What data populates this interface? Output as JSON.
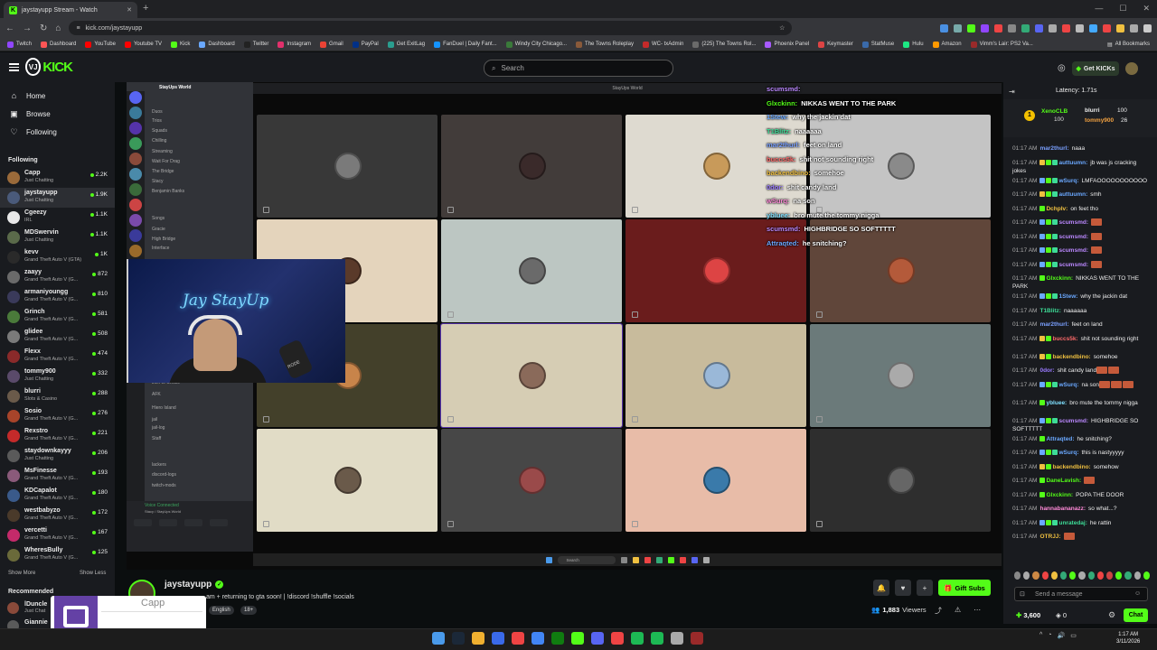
{
  "browser": {
    "tab_title": "jaystayupp Stream - Watch",
    "url": "kick.com/jaystayupp",
    "bookmarks": [
      "Twitch",
      "Dashboard",
      "YouTube",
      "Youtube TV",
      "Kick",
      "Dashboard",
      "Twitter",
      "Instagram",
      "Gmail",
      "PayPal",
      "Get ExitLag",
      "FanDuel | Daily Fant...",
      "Windy City Chicago...",
      "The Towns Roleplay",
      "WC- txAdmin",
      "(225) The Towns Rol...",
      "Phoenix Panel",
      "Keymaster",
      "StatMuse",
      "Hulu",
      "Amazon",
      "Vimm's Lair: PS2 Va..."
    ],
    "all_bookmarks": "All Bookmarks"
  },
  "header": {
    "search_placeholder": "Search",
    "get_kicks": "Get KICKs"
  },
  "nav": {
    "home": "Home",
    "browse": "Browse",
    "following": "Following"
  },
  "following_heading": "Following",
  "following": [
    {
      "name": "Capp",
      "category": "Just Chatting",
      "viewers": "2.2K",
      "color": "#9a6a3a"
    },
    {
      "name": "jaystayupp",
      "category": "Just Chatting",
      "viewers": "1.9K",
      "color": "#4a5a7a"
    },
    {
      "name": "Cgeezy",
      "category": "IRL",
      "viewers": "1.1K",
      "color": "#e8e8e8"
    },
    {
      "name": "MDSwervin",
      "category": "Just Chatting",
      "viewers": "1.1K",
      "color": "#5a6a4a"
    },
    {
      "name": "kevv",
      "category": "Grand Theft Auto V (GTA)",
      "viewers": "1K",
      "color": "#2a2a2a"
    },
    {
      "name": "zaayy",
      "category": "Grand Theft Auto V (G...",
      "viewers": "872",
      "color": "#6a6a6a"
    },
    {
      "name": "armaniyoungg",
      "category": "Grand Theft Auto V (G...",
      "viewers": "810",
      "color": "#3a3a5a"
    },
    {
      "name": "Grinch",
      "category": "Grand Theft Auto V (G...",
      "viewers": "581",
      "color": "#4a7a3a"
    },
    {
      "name": "glidee",
      "category": "Grand Theft Auto V (G...",
      "viewers": "508",
      "color": "#7a7a7a"
    },
    {
      "name": "Flexx",
      "category": "Grand Theft Auto V (G...",
      "viewers": "474",
      "color": "#8a2a2a"
    },
    {
      "name": "tommy900",
      "category": "Just Chatting",
      "viewers": "332",
      "color": "#5a4a6a"
    },
    {
      "name": "blurri",
      "category": "Slots & Casino",
      "viewers": "288",
      "color": "#6a5a4a"
    },
    {
      "name": "Sosio",
      "category": "Grand Theft Auto V (G...",
      "viewers": "276",
      "color": "#a8442a"
    },
    {
      "name": "Rexstro",
      "category": "Grand Theft Auto V (G...",
      "viewers": "221",
      "color": "#c42a2a"
    },
    {
      "name": "staydownkayyy",
      "category": "Just Chatting",
      "viewers": "206",
      "color": "#5a5a5a"
    },
    {
      "name": "MsFinesse",
      "category": "Grand Theft Auto V (G...",
      "viewers": "193",
      "color": "#8a5a7a"
    },
    {
      "name": "KDCapalot",
      "category": "Grand Theft Auto V (G...",
      "viewers": "180",
      "color": "#3a5a8a"
    },
    {
      "name": "westbabyzo",
      "category": "Grand Theft Auto V (G...",
      "viewers": "172",
      "color": "#4a3a2a"
    },
    {
      "name": "vercetti",
      "category": "Grand Theft Auto V (G...",
      "viewers": "167",
      "color": "#c42a6a"
    },
    {
      "name": "WheresBully",
      "category": "Grand Theft Auto V (G...",
      "viewers": "125",
      "color": "#6a6a3a"
    }
  ],
  "show_more": "Show More",
  "show_less": "Show Less",
  "recommended_heading": "Recommended",
  "recommended": [
    {
      "name": "lDuncle",
      "category": "Just Chat",
      "color": "#8a4a3a"
    },
    {
      "name": "Giannie",
      "category": "",
      "color": "#5a5a5a"
    }
  ],
  "stream": {
    "discord_server": "StayUps World",
    "discord_channels": [
      "Duos",
      "Trios",
      "Squads",
      "Chilling",
      "Streaming",
      "Wait For Drag",
      "The Bridge",
      "Stacy",
      "Benjamin Banks",
      "Songs",
      "Gracie",
      "High Bridge",
      "Interface",
      "Join to Create",
      "AFK",
      "Hiero Island",
      "jail",
      "jail-log",
      "Staff",
      "lackers",
      "discord-logs",
      "twitch-mods"
    ],
    "voice_connected": "Voice Connected",
    "voice_sub": "Stacy / StayUps World",
    "window_title": "StayUps World",
    "neon_sign": "Jay StayUp",
    "mic_brand": "RODE",
    "overlay_chat": [
      {
        "user": "scumsmd:",
        "text": "",
        "color": "#bb88ff"
      },
      {
        "user": "Glxckinn:",
        "text": "NIKKAS WENT TO THE PARK",
        "color": "#53fc18"
      },
      {
        "user": "1Stew:",
        "text": "why the jackin dat",
        "color": "#6aa8ff"
      },
      {
        "user": "T1Blitz:",
        "text": "naaaaaa",
        "color": "#3ddc97"
      },
      {
        "user": "mar2thurl:",
        "text": "feet on land",
        "color": "#7aa0ff"
      },
      {
        "user": "buccs5k:",
        "text": "shit not sounding right",
        "color": "#ff6a6a"
      },
      {
        "user": "backendbino:",
        "text": "somehoe",
        "color": "#f0c040"
      },
      {
        "user": "0dor:",
        "text": "shit candy land",
        "color": "#9a7aff"
      },
      {
        "user": "wSurq:",
        "text": "na son",
        "color": "#ff8ad8"
      },
      {
        "user": "ybluee:",
        "text": "bro mute the tommy nigga",
        "color": "#7fe0ff"
      },
      {
        "user": "scumsmd:",
        "text": "HIGHBRIDGE SO SOFTTTTT",
        "color": "#bb88ff"
      },
      {
        "user": "Attraqted:",
        "text": "he snitching?",
        "color": "#6aa8ff"
      }
    ],
    "taskbar_search": "Search",
    "status_line": "Ealey days ahead"
  },
  "streamer": {
    "name": "jaystayupp",
    "title": "am + returning to gta soon! | !discord !shuffle !socials",
    "tags": [
      "English",
      "18+"
    ],
    "viewers": "1,883",
    "viewers_label": "Viewers",
    "gift_subs": "Gift Subs"
  },
  "popup": {
    "name": "Capp"
  },
  "chat": {
    "latency": "Latency: 1.71s",
    "top": [
      {
        "name": "XenoCLB",
        "amount": "100"
      },
      {
        "name": "blurri",
        "amount": "100"
      },
      {
        "name": "tommy900",
        "amount": "26"
      }
    ],
    "messages": [
      {
        "time": "01:17 AM",
        "user": "mar2thurl:",
        "text": "naaa",
        "color": "#7aa0ff",
        "badges": []
      },
      {
        "time": "01:17 AM",
        "user": "auttuumn:",
        "text": "jb was js cracking jokes",
        "color": "#6aa8ff",
        "badges": [
          "#f0c040",
          "#53fc18",
          "#3ddc97"
        ]
      },
      {
        "time": "01:17 AM",
        "user": "wSurq:",
        "text": "LMFAOOOOOOOOOOO",
        "color": "#6aa8ff",
        "badges": [
          "#6aa8ff",
          "#53fc18",
          "#3ddc97"
        ]
      },
      {
        "time": "01:17 AM",
        "user": "auttuumn:",
        "text": "smh",
        "color": "#6aa8ff",
        "badges": [
          "#f0c040",
          "#53fc18",
          "#3ddc97"
        ]
      },
      {
        "time": "01:17 AM",
        "user": "Dchplv:",
        "text": "on feet tho",
        "color": "#f0c040",
        "badges": [
          "#53fc18"
        ]
      },
      {
        "time": "01:17 AM",
        "user": "scumsmd:",
        "text": "",
        "color": "#bb88ff",
        "badges": [
          "#6aa8ff",
          "#53fc18",
          "#3ddc97"
        ],
        "emotes": 1
      },
      {
        "time": "01:17 AM",
        "user": "scumsmd:",
        "text": "",
        "color": "#bb88ff",
        "badges": [
          "#6aa8ff",
          "#53fc18",
          "#3ddc97"
        ],
        "emotes": 1
      },
      {
        "time": "01:17 AM",
        "user": "scumsmd:",
        "text": "",
        "color": "#bb88ff",
        "badges": [
          "#6aa8ff",
          "#53fc18",
          "#3ddc97"
        ],
        "emotes": 1
      },
      {
        "time": "01:17 AM",
        "user": "scumsmd:",
        "text": "",
        "color": "#bb88ff",
        "badges": [
          "#6aa8ff",
          "#53fc18",
          "#3ddc97"
        ],
        "emotes": 1
      },
      {
        "time": "01:17 AM",
        "user": "Glxckinn:",
        "text": "NIKKAS WENT TO THE PARK",
        "color": "#53fc18",
        "badges": [
          "#53fc18"
        ]
      },
      {
        "time": "01:17 AM",
        "user": "1Stew:",
        "text": "why the jackin dat",
        "color": "#6aa8ff",
        "badges": [
          "#6aa8ff",
          "#53fc18",
          "#3ddc97"
        ]
      },
      {
        "time": "01:17 AM",
        "user": "T1Blitz:",
        "text": "naaaaaa",
        "color": "#3ddc97",
        "badges": []
      },
      {
        "time": "01:17 AM",
        "user": "mar2thurl:",
        "text": "feet on land",
        "color": "#7aa0ff",
        "badges": []
      },
      {
        "time": "01:17 AM",
        "user": "buccs5k:",
        "text": "shit not sounding right",
        "color": "#ff6a6a",
        "badges": [
          "#f0c040",
          "#53fc18"
        ]
      },
      {
        "time": "01:17 AM",
        "user": "backendbino:",
        "text": "somehoe",
        "color": "#f0c040",
        "badges": [
          "#f0c040",
          "#53fc18"
        ]
      },
      {
        "time": "01:17 AM",
        "user": "0dor:",
        "text": "shit candy land",
        "color": "#9a7aff",
        "badges": [],
        "emotes": 2
      },
      {
        "time": "01:17 AM",
        "user": "wSurq:",
        "text": "na son",
        "color": "#6aa8ff",
        "badges": [
          "#6aa8ff",
          "#53fc18",
          "#3ddc97"
        ],
        "emotes": 3
      },
      {
        "time": "01:17 AM",
        "user": "ybluee:",
        "text": "bro mute the tommy nigga",
        "color": "#7fe0ff",
        "badges": [
          "#53fc18"
        ]
      },
      {
        "time": "01:17 AM",
        "user": "scumsmd:",
        "text": "HIGHBRIDGE SO SOFTTTTT",
        "color": "#bb88ff",
        "badges": [
          "#6aa8ff",
          "#53fc18",
          "#3ddc97"
        ]
      },
      {
        "time": "01:17 AM",
        "user": "Attraqted:",
        "text": "he snitching?",
        "color": "#6aa8ff",
        "badges": [
          "#53fc18"
        ]
      },
      {
        "time": "01:17 AM",
        "user": "wSurq:",
        "text": "this is nastyyyyy",
        "color": "#6aa8ff",
        "badges": [
          "#6aa8ff",
          "#53fc18",
          "#3ddc97"
        ]
      },
      {
        "time": "01:17 AM",
        "user": "backendbino:",
        "text": "somehow",
        "color": "#f0c040",
        "badges": [
          "#f0c040",
          "#53fc18"
        ]
      },
      {
        "time": "01:17 AM",
        "user": "DaneLavish:",
        "text": "",
        "color": "#53fc18",
        "badges": [
          "#53fc18"
        ],
        "emotes": 1
      },
      {
        "time": "01:17 AM",
        "user": "Glxckinn:",
        "text": "POPA THE DOOR",
        "color": "#53fc18",
        "badges": [
          "#53fc18"
        ]
      },
      {
        "time": "01:17 AM",
        "user": "hannabananazz:",
        "text": "so what...?",
        "color": "#ff8ad8",
        "badges": []
      },
      {
        "time": "01:17 AM",
        "user": "unratedaj:",
        "text": "he rattin",
        "color": "#3ddc97",
        "badges": [
          "#6aa8ff",
          "#53fc18",
          "#3ddc97"
        ]
      },
      {
        "time": "01:17 AM",
        "user": "OTRJJ:",
        "text": "",
        "color": "#f0c040",
        "badges": [],
        "emotes": 1
      }
    ],
    "send_placeholder": "Send a message",
    "points": "3,600",
    "points2": "0",
    "chat_button": "Chat"
  },
  "clock": {
    "time": "1:17 AM",
    "date": "3/11/2026"
  },
  "colors": {
    "accent": "#53fc18",
    "bg": "#0b0e0f",
    "sidebar": "#191b1f"
  }
}
